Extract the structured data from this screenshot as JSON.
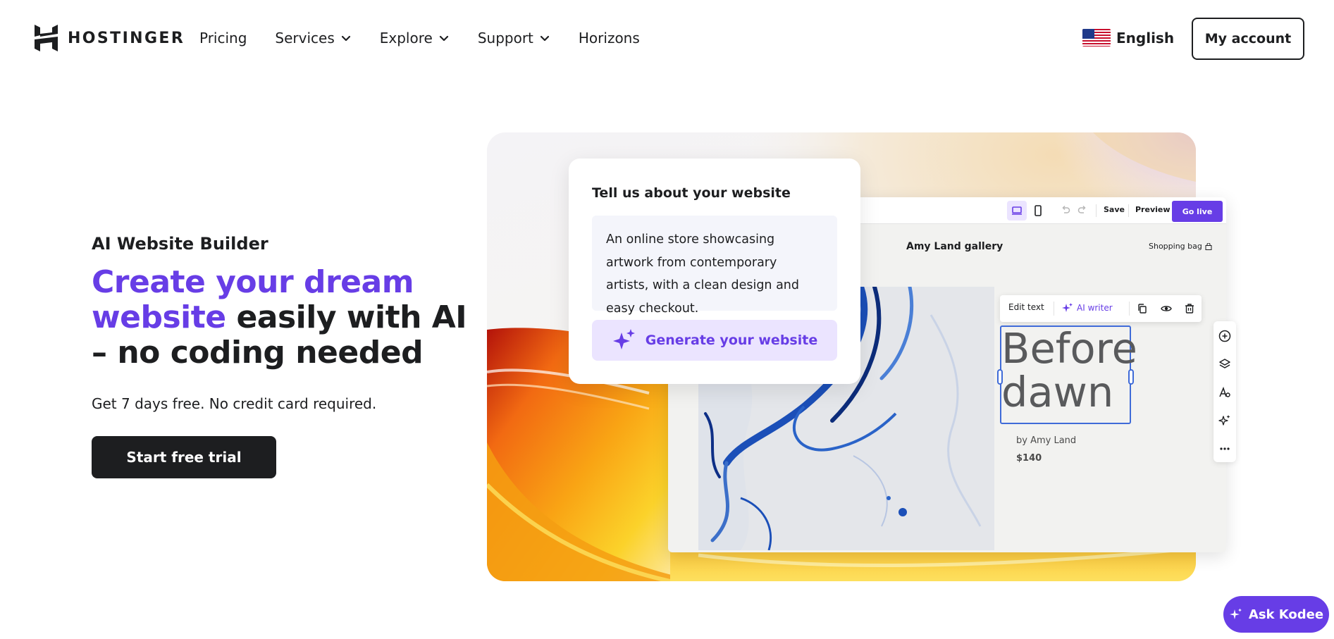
{
  "header": {
    "brand": "HOSTINGER",
    "nav": [
      {
        "label": "Pricing",
        "dropdown": false
      },
      {
        "label": "Services",
        "dropdown": true
      },
      {
        "label": "Explore",
        "dropdown": true
      },
      {
        "label": "Support",
        "dropdown": true
      },
      {
        "label": "Horizons",
        "dropdown": false
      }
    ],
    "language": "English",
    "account_label": "My account"
  },
  "hero": {
    "eyebrow": "AI Website Builder",
    "headline_highlight": "Create your dream website",
    "headline_rest": " easily with AI – no coding needed",
    "subtext": "Get 7 days free. No credit card required.",
    "cta_label": "Start free trial"
  },
  "prompt_card": {
    "title": "Tell us about your website",
    "input_text": "An online store showcasing artwork from contemporary artists, with a clean design and easy checkout.",
    "button_label": "Generate your website"
  },
  "builder": {
    "toolbar": {
      "save_label": "Save",
      "preview_label": "Preview",
      "golive_label": "Go live"
    },
    "site_title": "Amy Land gallery",
    "shopping_bag": "Shopping bag",
    "text_toolbar": {
      "edit_label": "Edit text",
      "ai_label": "AI writer"
    },
    "artwork_title": "Before dawn",
    "artwork_by": "by Amy Land",
    "artwork_price": "$140"
  },
  "chat": {
    "label": "Ask Kodee"
  },
  "colors": {
    "brand_purple": "#673de6",
    "dark": "#1d1e20",
    "selection_blue": "#3f6bd8",
    "light_purple": "#ebe4ff"
  },
  "icons": [
    "hostinger-logo-icon",
    "chevron-down-icon",
    "us-flag-icon",
    "desktop-icon",
    "mobile-icon",
    "undo-icon",
    "redo-icon",
    "shopping-bag-icon",
    "sparkle-icon",
    "copy-icon",
    "eye-icon",
    "trash-icon",
    "plus-circle-icon",
    "layers-icon",
    "typography-icon",
    "ai-sparkle-icon",
    "more-icon",
    "kodee-icon"
  ]
}
